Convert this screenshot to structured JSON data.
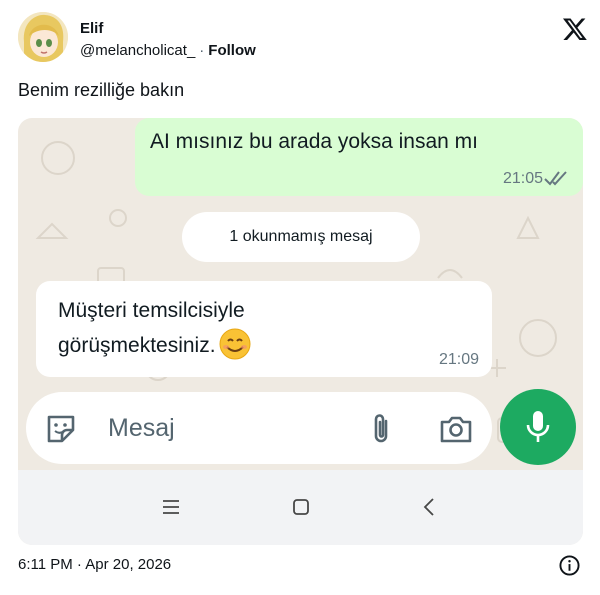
{
  "tweet": {
    "author_name": "Elif",
    "handle": "@melancholicat_",
    "separator": "·",
    "follow_label": "Follow",
    "text": "Benim rezilliğe bakın",
    "timestamp": "6:11 PM · Apr 20, 2026"
  },
  "chat": {
    "outgoing": {
      "text": "AI mısınız bu arada yoksa insan mı",
      "time": "21:05"
    },
    "unread_banner": "1 okunmamış mesaj",
    "incoming": {
      "text": "Müşteri temsilcisiyle görüşmektesiniz.",
      "emoji": "smiling-face",
      "time": "21:09"
    },
    "input_placeholder": "Mesaj"
  },
  "colors": {
    "outgoing_bubble": "#d9fdd3",
    "chat_background": "#efeae2",
    "mic_button": "#1daa61",
    "read_ticks": "#667781"
  },
  "icons": [
    "x-logo-icon",
    "double-check-icon",
    "sticker-icon",
    "paperclip-icon",
    "camera-icon",
    "microphone-icon",
    "menu-icon",
    "home-icon",
    "back-icon",
    "info-icon"
  ]
}
